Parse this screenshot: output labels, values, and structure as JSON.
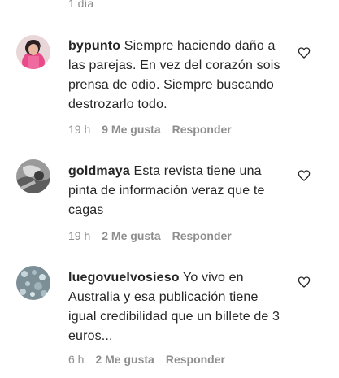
{
  "top_meta": {
    "time": "1 día"
  },
  "comments": [
    {
      "username": "bypunto",
      "text": "Siempre haciendo daño a las parejas. En vez del corazón sois prensa de odio. Siempre buscando destrozarlo todo.",
      "time": "19 h",
      "likes": "9 Me gusta",
      "reply": "Responder",
      "avatar_icon": "profile-photo-icon"
    },
    {
      "username": "goldmaya",
      "text": "Esta revista tiene una pinta de información veraz que te cagas",
      "time": "19 h",
      "likes": "2 Me gusta",
      "reply": "Responder",
      "avatar_icon": "profile-photo-icon"
    },
    {
      "username": "luegovuelvosieso",
      "text": "Yo vivo en Australia y esa publicación tiene igual credibilidad que un billete de 3 euros...",
      "time": "6 h",
      "likes": "2 Me gusta",
      "reply": "Responder",
      "avatar_icon": "profile-photo-icon"
    }
  ],
  "icons": {
    "like": "heart-outline-icon"
  },
  "colors": {
    "text": "#262626",
    "meta": "#8e8e8e",
    "background": "#ffffff"
  }
}
